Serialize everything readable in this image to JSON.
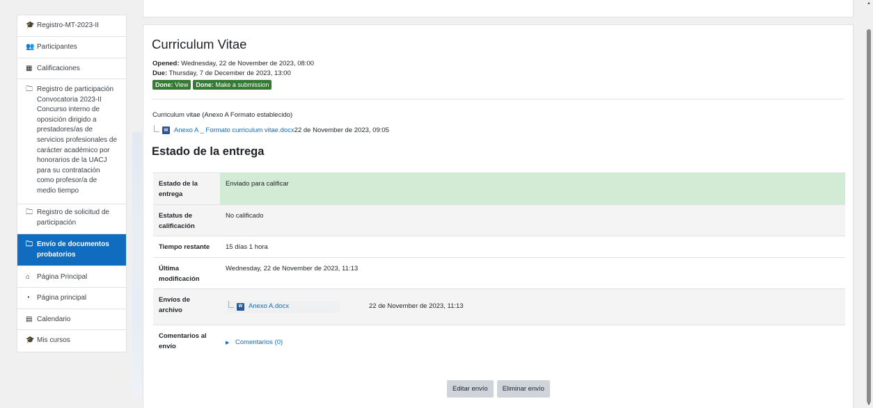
{
  "sidebar": {
    "items": [
      {
        "icon": "graduation-cap-icon",
        "glyph": "🎓",
        "label": "Registro-MT-2023-II"
      },
      {
        "icon": "users-icon",
        "glyph": "👥",
        "label": "Participantes"
      },
      {
        "icon": "table-icon",
        "glyph": "▦",
        "label": "Calificaciones"
      },
      {
        "icon": "folder-icon",
        "glyph": "🗀",
        "label": "Registro de participación Convocatoria 2023-II Concurso interno de oposición dirigido a prestadores/as de servicios profesionales de carácter académico por honorarios de la UACJ para su contratación como profesor/a de medio tiempo"
      },
      {
        "icon": "folder-icon",
        "glyph": "🗀",
        "label": "Registro de solicitud de participación"
      },
      {
        "icon": "folder-icon",
        "glyph": "🗀",
        "label": "Envío de documentos probatorios",
        "active": true
      },
      {
        "icon": "home-icon",
        "glyph": "⌂",
        "label": "Página Principal"
      },
      {
        "icon": "tachometer-icon",
        "glyph": "◔",
        "label": "Página principal"
      },
      {
        "icon": "calendar-icon",
        "glyph": "▤",
        "label": "Calendario"
      },
      {
        "icon": "graduation-cap-icon",
        "glyph": "🎓",
        "label": "Mis cursos"
      }
    ]
  },
  "activity": {
    "title": "Curriculum Vitae",
    "opened_label": "Opened:",
    "opened_value": " Wednesday, 22 de November de 2023, 08:00",
    "due_label": "Due:",
    "due_value": " Thursday, 7 de December de 2023, 13:00",
    "badges": [
      {
        "strong": "Done:",
        "text": " View"
      },
      {
        "strong": "Done:",
        "text": " Make a submission"
      }
    ],
    "intro": "Curriculum vitae (Anexo A Formato establecido)",
    "intro_file_link": "Anexo A _ Formato curriculum vitae.docx",
    "intro_file_date": "22 de November de 2023, 09:05"
  },
  "submission": {
    "heading": "Estado de la entrega",
    "rows": {
      "status_label": "Estado de la entrega",
      "status_value": "Enviado para calificar",
      "grading_label": "Estatus de calificación",
      "grading_value": "No calificado",
      "time_label": "Tiempo restante",
      "time_value": "15 días 1 hora",
      "modified_label": "Última modificación",
      "modified_value": "Wednesday, 22 de November de 2023, 11:13",
      "files_label": "Envíos de archivo",
      "file_name": "Anexo A.docx",
      "file_date": "22 de November de 2023, 11:13",
      "comments_label": "Comentarios al envío",
      "comments_link": "Comentarios (0)"
    }
  },
  "buttons": {
    "edit": "Editar envío",
    "remove": "Eliminar envío"
  },
  "colors": {
    "accent": "#0f6cbf",
    "success_badge": "#357a32",
    "submitted_row": "#d2ebd4"
  }
}
